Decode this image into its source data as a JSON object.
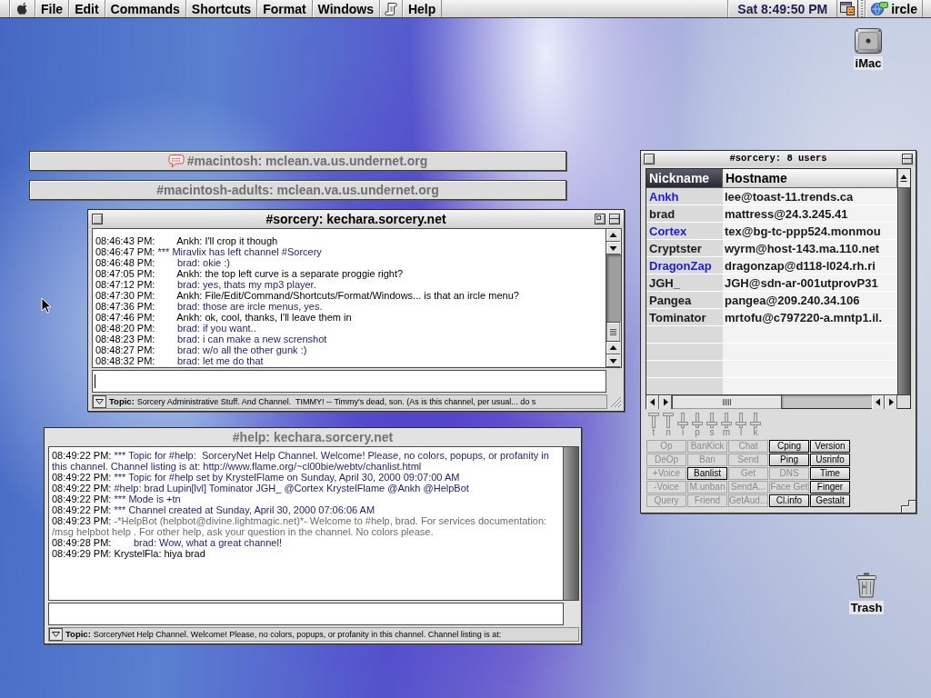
{
  "menu_bar": {
    "menus": [
      "File",
      "Edit",
      "Commands",
      "Shortcuts",
      "Format",
      "Windows"
    ],
    "help_menu": "Help",
    "clock": "Sat 8:49:50 PM",
    "application_menu": "ircle"
  },
  "desktop_icons": [
    {
      "kind": "drive",
      "label": "iMac"
    },
    {
      "kind": "trash",
      "label": "Trash"
    }
  ],
  "collapsed_windows": [
    {
      "title": "#macintosh: mclean.va.us.undernet.org",
      "new_activity": true
    },
    {
      "title": "#macintosh-adults: mclean.va.us.undernet.org",
      "new_activity": false
    }
  ],
  "channel_windows": [
    {
      "title": "#sorcery: kechara.sorcery.net",
      "active": true,
      "messages": [
        {
          "time": "08:46:43 PM:",
          "text": "       Ankh: I'll crop it though",
          "color": "#000000"
        },
        {
          "time": "08:46:47 PM:",
          "text": "*** Miravlix has left channel #Sorcery",
          "color": "#22227a"
        },
        {
          "time": "08:46:48 PM:",
          "text": "       brad: okie :)",
          "color": "#22227a"
        },
        {
          "time": "08:47:05 PM:",
          "text": "       Ankh: the top left curve is a separate proggie right?",
          "color": "#000000"
        },
        {
          "time": "08:47:12 PM:",
          "text": "       brad: yes, thats my mp3 player.",
          "color": "#22227a"
        },
        {
          "time": "08:47:30 PM:",
          "text": "       Ankh: File/Edit/Command/Shortcuts/Format/Windows... is that an ircle menu?",
          "color": "#000000"
        },
        {
          "time": "08:47:36 PM:",
          "text": "       brad: those are ircle menus, yes.",
          "color": "#22227a"
        },
        {
          "time": "08:47:46 PM:",
          "text": "       Ankh: ok, cool, thanks, I'll leave them in",
          "color": "#000000"
        },
        {
          "time": "08:48:20 PM:",
          "text": "       brad: if you want..",
          "color": "#22227a"
        },
        {
          "time": "08:48:23 PM:",
          "text": "       brad: i can make a new screnshot",
          "color": "#22227a"
        },
        {
          "time": "08:48:27 PM:",
          "text": "       brad: w/o all the other gunk :)",
          "color": "#22227a"
        },
        {
          "time": "08:48:32 PM:",
          "text": "       brad: let me do that",
          "color": "#22227a"
        }
      ],
      "topic_label": "Topic:",
      "topic": "Sorcery Administrative Stuff. And Channel.  TIMMY! -- Timmy's dead, son. (As is this channel, per usual... do s"
    },
    {
      "title": "#help: kechara.sorcery.net",
      "active": false,
      "messages": [
        {
          "time": "08:49:22 PM:",
          "text": "*** Topic for #help:  SorceryNet Help Channel. Welcome! Please, no colors, popups, or profanity in this channel. Channel listing is at: http://www.flame.org/~cl00bie/webtv/chanlist.html",
          "color": "#22227a"
        },
        {
          "time": "08:49:22 PM:",
          "text": "*** Topic for #help set by KrystelFlame on Sunday, April 30, 2000 09:07:00 AM",
          "color": "#22227a"
        },
        {
          "time": "08:49:22 PM:",
          "text": "#help: brad Lupin[lvl] Tominator JGH_ @Cortex KrystelFlame @Ankh @HelpBot",
          "color": "#22227a"
        },
        {
          "time": "08:49:22 PM:",
          "text": "*** Mode is +tn",
          "color": "#22227a"
        },
        {
          "time": "08:49:22 PM:",
          "text": "*** Channel created at Sunday, April 30, 2000 07:06:06 AM",
          "color": "#22227a"
        },
        {
          "time": "08:49:23 PM:",
          "text": "-*HelpBot (helpbot@divine.lightmagic.net)*- Welcome to #help, brad. For services documentation: /msg helpbot help . For other help, ask your question in the channel. No colors please.",
          "color": "#6b6b6b"
        },
        {
          "time": "08:49:28 PM:",
          "text": "       brad: Wow, what a great channel!",
          "color": "#22227a"
        },
        {
          "time": "08:49:29 PM:",
          "text": "KrystelFla: hiya brad",
          "color": "#000000"
        }
      ],
      "topic_label": "Topic:",
      "topic": "SorceryNet Help Channel. Welcome! Please, no colors, popups, or profanity in this channel. Channel listing is at:"
    }
  ],
  "user_list": {
    "title": "#sorcery: 8 users",
    "columns": [
      {
        "label": "Nickname",
        "sorted": true
      },
      {
        "label": "Hostname",
        "sorted": false
      }
    ],
    "users": [
      {
        "nickname": "Ankh",
        "hostname": "lee@toast-11.trends.ca",
        "op": true
      },
      {
        "nickname": "brad",
        "hostname": "mattress@24.3.245.41",
        "op": false
      },
      {
        "nickname": "Cortex",
        "hostname": "tex@bg-tc-ppp524.monmou",
        "op": true
      },
      {
        "nickname": "Cryptster",
        "hostname": "wyrm@host-143.ma.110.net",
        "op": false
      },
      {
        "nickname": "DragonZap",
        "hostname": "dragonzap@d118-l024.rh.ri",
        "op": true
      },
      {
        "nickname": "JGH_",
        "hostname": "JGH@sdn-ar-001utprovP31",
        "op": false
      },
      {
        "nickname": "Pangea",
        "hostname": "pangea@209.240.34.106",
        "op": false
      },
      {
        "nickname": "Tominator",
        "hostname": "mrtofu@c797220-a.mntp1.il.",
        "op": false
      }
    ],
    "modes": [
      {
        "label": "t",
        "on": true
      },
      {
        "label": "n",
        "on": true
      },
      {
        "label": "i",
        "on": false
      },
      {
        "label": "p",
        "on": false
      },
      {
        "label": "s",
        "on": false
      },
      {
        "label": "m",
        "on": false
      },
      {
        "label": "l",
        "on": false
      },
      {
        "label": "k",
        "on": false
      }
    ],
    "buttons": [
      {
        "label": "Op",
        "disabled": true
      },
      {
        "label": "BanKick",
        "disabled": true
      },
      {
        "label": "Chat",
        "disabled": true
      },
      {
        "label": "Cping",
        "disabled": false
      },
      {
        "label": "Version",
        "disabled": false
      },
      {
        "label": "DeOp",
        "disabled": true
      },
      {
        "label": "Ban",
        "disabled": true
      },
      {
        "label": "Send",
        "disabled": true
      },
      {
        "label": "Ping",
        "disabled": false
      },
      {
        "label": "Usrinfo",
        "disabled": false
      },
      {
        "label": "+Voice",
        "disabled": true
      },
      {
        "label": "Banlist",
        "disabled": false
      },
      {
        "label": "Get",
        "disabled": true
      },
      {
        "label": "DNS",
        "disabled": true
      },
      {
        "label": "Time",
        "disabled": false
      },
      {
        "label": "-Voice",
        "disabled": true
      },
      {
        "label": "M.unban",
        "disabled": true
      },
      {
        "label": "SendA...",
        "disabled": true
      },
      {
        "label": "Face Get",
        "disabled": true
      },
      {
        "label": "Finger",
        "disabled": false
      },
      {
        "label": "Query",
        "disabled": true
      },
      {
        "label": "Friend",
        "disabled": true
      },
      {
        "label": "GetAud...",
        "disabled": true
      },
      {
        "label": "Cl.info",
        "disabled": false
      },
      {
        "label": "Gestalt",
        "disabled": false
      }
    ]
  }
}
